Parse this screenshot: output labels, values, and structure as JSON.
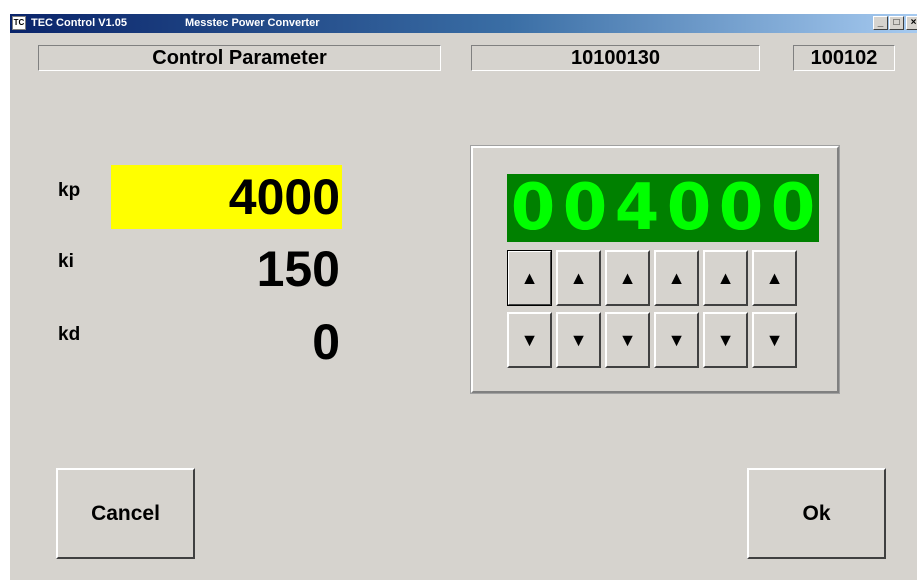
{
  "window": {
    "title": "TEC Control V1.05",
    "subtitle": "Messtec Power Converter",
    "icon_text": "TC",
    "minimize_glyph": "_",
    "maximize_glyph": "□",
    "close_glyph": "×"
  },
  "header": {
    "title": "Control Parameter",
    "serial": "10100130",
    "code": "100102"
  },
  "params": [
    {
      "label": "kp",
      "value": "4000",
      "selected": true
    },
    {
      "label": "ki",
      "value": "150",
      "selected": false
    },
    {
      "label": "kd",
      "value": "0",
      "selected": false
    }
  ],
  "editor": {
    "digits": [
      "0",
      "0",
      "4",
      "0",
      "0",
      "0"
    ],
    "up_glyph": "▲",
    "down_glyph": "▼",
    "display_bg": "#008000",
    "digit_color": "#00ff00"
  },
  "buttons": {
    "cancel": "Cancel",
    "ok": "Ok"
  },
  "colors": {
    "selected_field": "#ffff00",
    "background": "#d6d3ce"
  }
}
